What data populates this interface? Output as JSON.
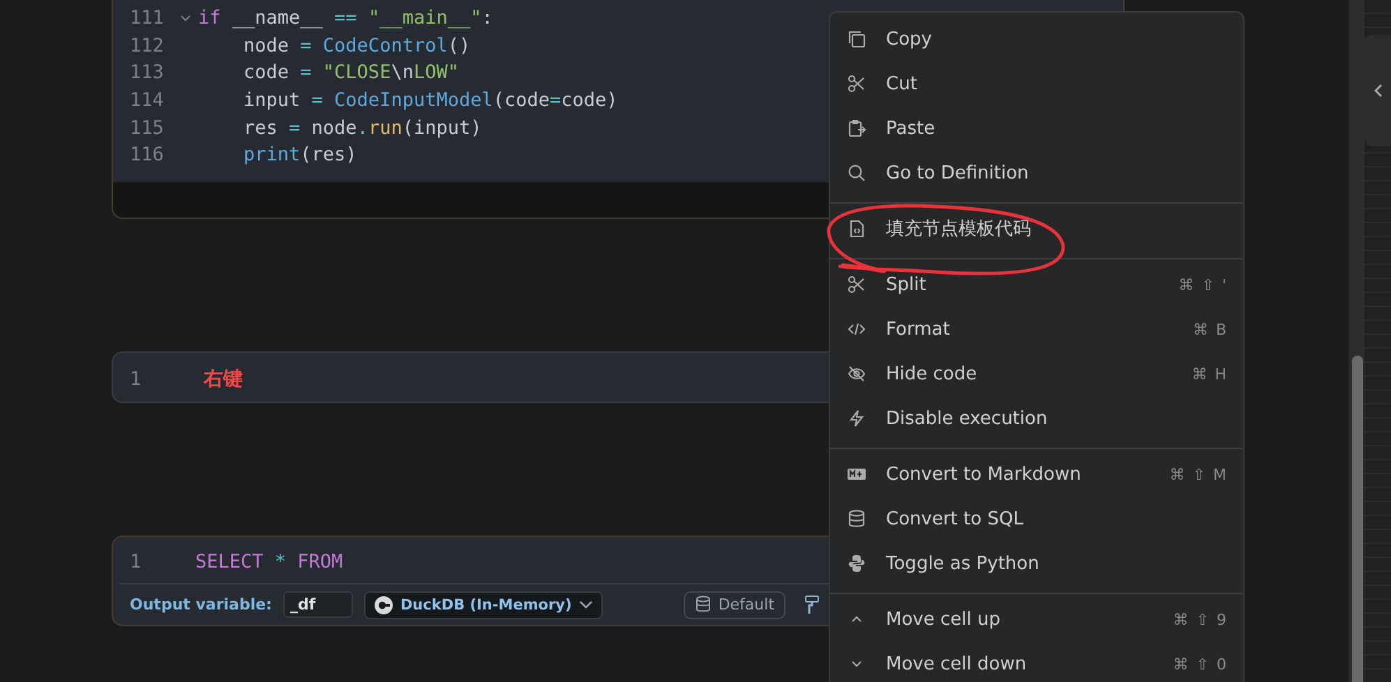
{
  "cells": [
    {
      "kind": "code",
      "lines": [
        {
          "number": "111",
          "fold": true,
          "tokens": [
            {
              "t": "if",
              "kind": "kw"
            },
            {
              "t": " __name__ ",
              "kind": "plain"
            },
            {
              "t": "==",
              "kind": "op"
            },
            {
              "t": " \"__main__\"",
              "kind": "str"
            },
            {
              "t": ":",
              "kind": "plain"
            }
          ]
        },
        {
          "number": "112",
          "fold": false,
          "tokens": [
            {
              "t": "    node ",
              "kind": "plain"
            },
            {
              "t": "=",
              "kind": "op"
            },
            {
              "t": " CodeControl",
              "kind": "fn"
            },
            {
              "t": "()",
              "kind": "plain"
            }
          ]
        },
        {
          "number": "113",
          "fold": false,
          "tokens": [
            {
              "t": "    code ",
              "kind": "plain"
            },
            {
              "t": "=",
              "kind": "op"
            },
            {
              "t": " \"CLOSE",
              "kind": "str"
            },
            {
              "t": "\\n",
              "kind": "plain"
            },
            {
              "t": "LOW\"",
              "kind": "str"
            }
          ]
        },
        {
          "number": "114",
          "fold": false,
          "tokens": [
            {
              "t": "    input ",
              "kind": "plain"
            },
            {
              "t": "=",
              "kind": "op"
            },
            {
              "t": " CodeInputModel",
              "kind": "fn"
            },
            {
              "t": "(code",
              "kind": "plain"
            },
            {
              "t": "=",
              "kind": "op"
            },
            {
              "t": "code)",
              "kind": "plain"
            }
          ]
        },
        {
          "number": "115",
          "fold": false,
          "tokens": [
            {
              "t": "    res ",
              "kind": "plain"
            },
            {
              "t": "=",
              "kind": "op"
            },
            {
              "t": " node",
              "kind": "plain"
            },
            {
              "t": ".",
              "kind": "op"
            },
            {
              "t": "run",
              "kind": "meth"
            },
            {
              "t": "(input)",
              "kind": "plain"
            }
          ]
        },
        {
          "number": "116",
          "fold": false,
          "tokens": [
            {
              "t": "    print",
              "kind": "fn"
            },
            {
              "t": "(res)",
              "kind": "plain"
            }
          ]
        }
      ]
    },
    {
      "kind": "note",
      "lines": [
        {
          "number": "1",
          "fold": false,
          "tokens": [
            {
              "t": "右键",
              "kind": "note"
            }
          ]
        }
      ]
    },
    {
      "kind": "sql",
      "lines": [
        {
          "number": "1",
          "fold": false,
          "tokens": [
            {
              "t": "SELECT",
              "kind": "kw"
            },
            {
              "t": " * ",
              "kind": "op"
            },
            {
              "t": "FROM",
              "kind": "kw"
            }
          ]
        }
      ],
      "footer": {
        "label": "Output variable:",
        "variable": "_df",
        "engine": "DuckDB (In-Memory)",
        "button": "Default"
      }
    }
  ],
  "context_menu": {
    "groups": [
      [
        {
          "label": "Copy"
        },
        {
          "label": "Cut"
        },
        {
          "label": "Paste"
        },
        {
          "label": "Go to Definition"
        }
      ],
      [
        {
          "label": "填充节点模板代码"
        }
      ],
      [
        {
          "label": "Split",
          "shortcut": [
            "⌘",
            "⇧",
            "'"
          ]
        },
        {
          "label": "Format",
          "shortcut": [
            "⌘",
            "B"
          ]
        },
        {
          "label": "Hide code",
          "shortcut": [
            "⌘",
            "H"
          ]
        },
        {
          "label": "Disable execution"
        }
      ],
      [
        {
          "label": "Convert to Markdown",
          "shortcut": [
            "⌘",
            "⇧",
            "M"
          ]
        },
        {
          "label": "Convert to SQL"
        },
        {
          "label": "Toggle as Python"
        }
      ],
      [
        {
          "label": "Move cell up",
          "shortcut": [
            "⌘",
            "⇧",
            "9"
          ]
        },
        {
          "label": "Move cell down",
          "shortcut": [
            "⌘",
            "⇧",
            "0"
          ]
        }
      ]
    ]
  }
}
